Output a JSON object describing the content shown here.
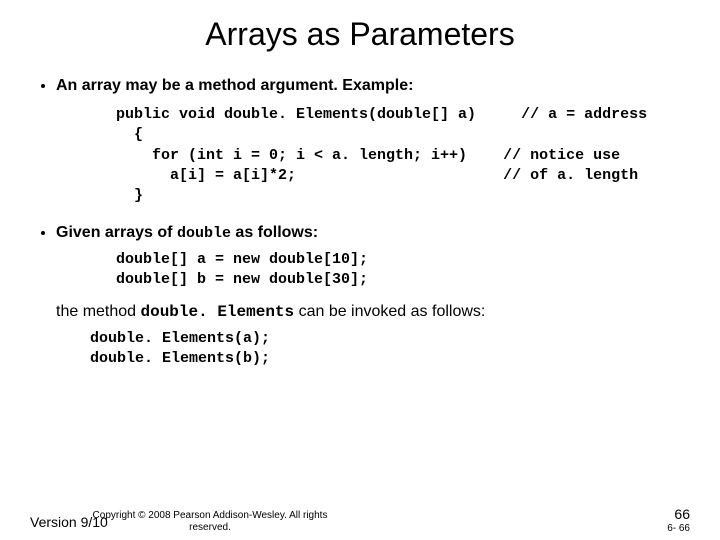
{
  "title": "Arrays as Parameters",
  "bullets": {
    "b1": "An array may be a method argument. Example:",
    "b2_pre": "Given arrays of ",
    "b2_code": "double",
    "b2_post": " as follows:"
  },
  "code1": "public void double. Elements(double[] a)     // a = address\n  {\n    for (int i = 0; i < a. length; i++)    // notice use\n      a[i] = a[i]*2;                       // of a. length\n  }",
  "code2": "double[] a = new double[10];\ndouble[] b = new double[30];",
  "para_pre": "the method ",
  "para_code": "double. Elements",
  "para_post": " can be invoked as follows:",
  "code3": "double. Elements(a);\ndouble. Elements(b);",
  "footer_version": "Version 9/10",
  "copyright": "Copyright © 2008 Pearson Addison-Wesley. All rights reserved.",
  "page_big": "66",
  "page_small": "6- 66"
}
